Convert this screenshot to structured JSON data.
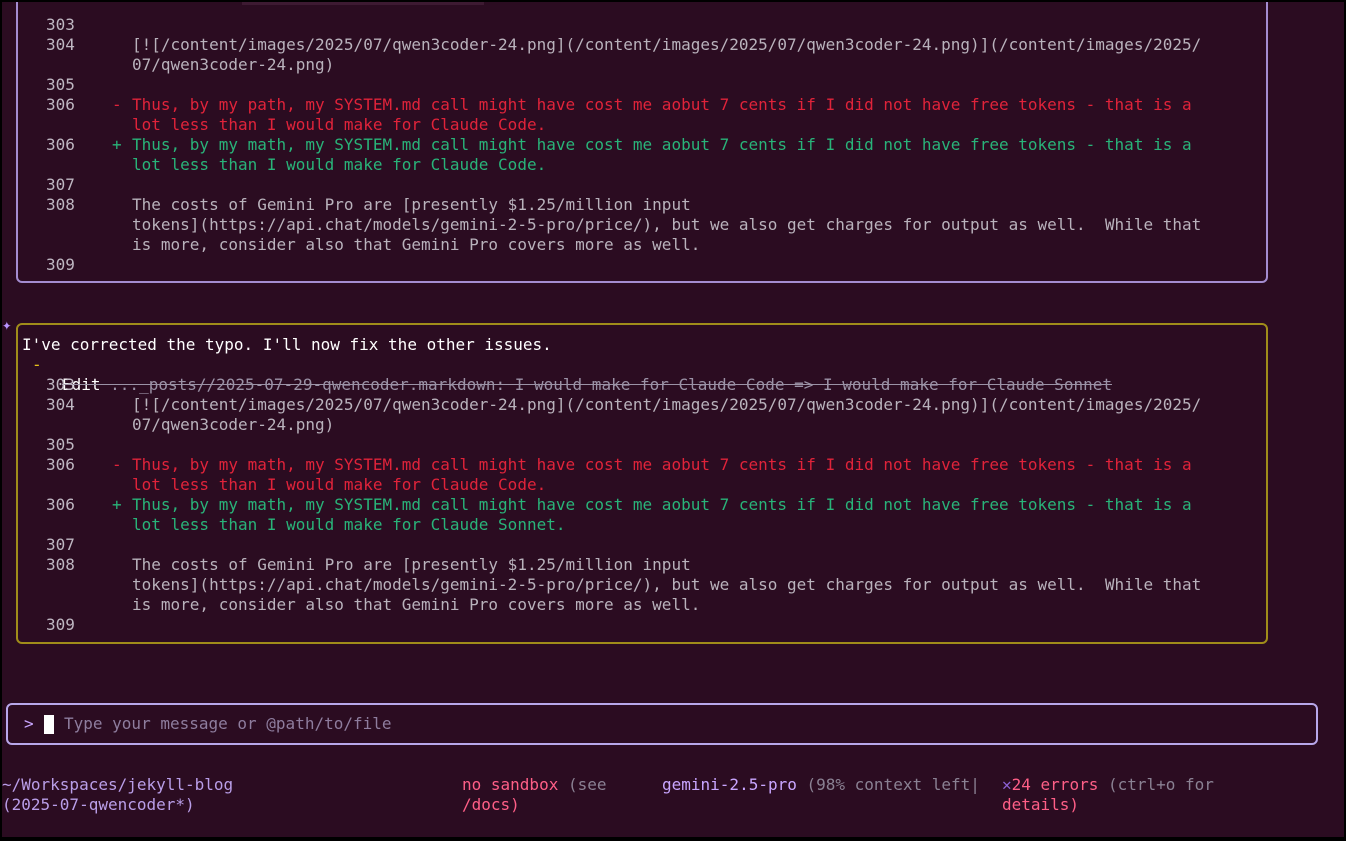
{
  "diff_box_1": {
    "lines": [
      {
        "num": "303",
        "sign": "",
        "text": "",
        "kind": "ctx"
      },
      {
        "num": "304",
        "sign": "",
        "text": "[![/content/images/2025/07/qwen3coder-24.png](/content/images/2025/07/qwen3coder-24.png)](/content/images/2025/",
        "kind": "ctx"
      },
      {
        "num": "",
        "sign": "",
        "text": "07/qwen3coder-24.png)",
        "kind": "ctx"
      },
      {
        "num": "305",
        "sign": "",
        "text": "",
        "kind": "ctx"
      },
      {
        "num": "306",
        "sign": "-",
        "text": "Thus, by my path, my SYSTEM.md call might have cost me aobut 7 cents if I did not have free tokens - that is a",
        "kind": "del"
      },
      {
        "num": "",
        "sign": "",
        "text": "lot less than I would make for Claude Code.",
        "kind": "del"
      },
      {
        "num": "306",
        "sign": "+",
        "text": "Thus, by my math, my SYSTEM.md call might have cost me aobut 7 cents if I did not have free tokens - that is a",
        "kind": "add"
      },
      {
        "num": "",
        "sign": "",
        "text": "lot less than I would make for Claude Code.",
        "kind": "add"
      },
      {
        "num": "307",
        "sign": "",
        "text": "",
        "kind": "ctx"
      },
      {
        "num": "308",
        "sign": "",
        "text": "The costs of Gemini Pro are [presently $1.25/million input",
        "kind": "ctx"
      },
      {
        "num": "",
        "sign": "",
        "text": "tokens](https://api.chat/models/gemini-2-5-pro/price/), but we also get charges for output as well.  While that",
        "kind": "ctx"
      },
      {
        "num": "",
        "sign": "",
        "text": "is more, consider also that Gemini Pro covers more as well.",
        "kind": "ctx"
      },
      {
        "num": "309",
        "sign": "",
        "text": "",
        "kind": "ctx"
      }
    ]
  },
  "assistant_message": {
    "icon": "sparkle-icon",
    "star": "✦",
    "text": "I've corrected the typo. I'll now fix the other issues."
  },
  "edit_box": {
    "status_icon": "-",
    "action": "Edit",
    "title": " ..._posts//2025-07-29-qwencoder.markdown: I would make for Claude Code => I would make for Claude Sonnet",
    "lines": [
      {
        "num": "303",
        "sign": "",
        "text": "",
        "kind": "ctx"
      },
      {
        "num": "304",
        "sign": "",
        "text": "[![/content/images/2025/07/qwen3coder-24.png](/content/images/2025/07/qwen3coder-24.png)](/content/images/2025/",
        "kind": "ctx"
      },
      {
        "num": "",
        "sign": "",
        "text": "07/qwen3coder-24.png)",
        "kind": "ctx"
      },
      {
        "num": "305",
        "sign": "",
        "text": "",
        "kind": "ctx"
      },
      {
        "num": "306",
        "sign": "-",
        "text": "Thus, by my math, my SYSTEM.md call might have cost me aobut 7 cents if I did not have free tokens - that is a",
        "kind": "del"
      },
      {
        "num": "",
        "sign": "",
        "text": "lot less than I would make for Claude Code.",
        "kind": "del"
      },
      {
        "num": "306",
        "sign": "+",
        "text": "Thus, by my math, my SYSTEM.md call might have cost me aobut 7 cents if I did not have free tokens - that is a",
        "kind": "add"
      },
      {
        "num": "",
        "sign": "",
        "text": "lot less than I would make for Claude Sonnet.",
        "kind": "add"
      },
      {
        "num": "307",
        "sign": "",
        "text": "",
        "kind": "ctx"
      },
      {
        "num": "308",
        "sign": "",
        "text": "The costs of Gemini Pro are [presently $1.25/million input",
        "kind": "ctx"
      },
      {
        "num": "",
        "sign": "",
        "text": "tokens](https://api.chat/models/gemini-2-5-pro/price/), but we also get charges for output as well.  While that",
        "kind": "ctx"
      },
      {
        "num": "",
        "sign": "",
        "text": "is more, consider also that Gemini Pro covers more as well.",
        "kind": "ctx"
      },
      {
        "num": "309",
        "sign": "",
        "text": "",
        "kind": "ctx"
      }
    ]
  },
  "input": {
    "prompt": ">",
    "placeholder": "Type your message or @path/to/file"
  },
  "status_bar": {
    "cwd_line1": "~/Workspaces/jekyll-blog",
    "cwd_line2": "(2025-07-qwencoder*)",
    "sandbox_label": "no sandbox",
    "sandbox_hint1": " (see",
    "sandbox_hint2": "/docs)",
    "model": "gemini-2.5-pro",
    "context": " (98% context left",
    "separator": "|",
    "error_icon": "✕",
    "error_icon_name": "error-x-icon",
    "errors": "24 errors",
    "errors_hint1": " (ctrl+o for",
    "errors_hint2": "details)"
  },
  "colors": {
    "background": "#2b0c21",
    "deleted": "#e0233a",
    "added": "#29b379",
    "box_border": "#a48cd0",
    "edit_border": "#a08d1a",
    "accent": "#c9a6ff",
    "error": "#ff5f87"
  }
}
